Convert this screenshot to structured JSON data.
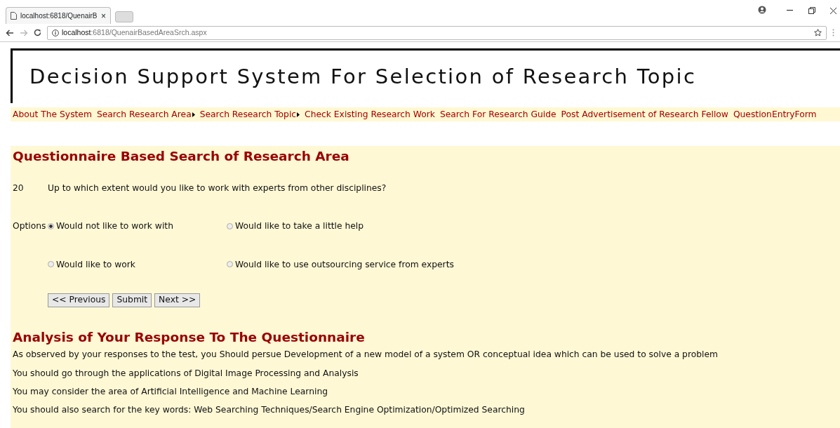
{
  "browser": {
    "tab_title": "localhost:6818/QuenairB",
    "tab_close": "×",
    "url_host": "localhost",
    "url_path": ":6818/QuenairBasedAreaSrch.aspx"
  },
  "header": {
    "title": "Decision Support System For Selection of Research Topic"
  },
  "menu": [
    {
      "label": "About The System",
      "has_submenu": false
    },
    {
      "label": "Search Research Area",
      "has_submenu": true
    },
    {
      "label": "Search Research Topic",
      "has_submenu": true
    },
    {
      "label": "Check Existing Research Work",
      "has_submenu": false
    },
    {
      "label": "Search For Research Guide",
      "has_submenu": false
    },
    {
      "label": "Post Advertisement of Research Fellow",
      "has_submenu": false
    },
    {
      "label": "QuestionEntryForm",
      "has_submenu": false
    }
  ],
  "questionnaire": {
    "heading": "Questionnaire Based Search of Research Area",
    "number": "20",
    "question": "Up to which extent would you like to work with experts from other disciplines?",
    "options_label": "Options",
    "options": [
      {
        "label": "Would not like to work with",
        "selected": true
      },
      {
        "label": "Would like to take a little help",
        "selected": false
      },
      {
        "label": "Would like to work",
        "selected": false
      },
      {
        "label": "Would like to use outsourcing service from experts",
        "selected": false
      }
    ],
    "buttons": [
      "<< Previous",
      "Submit",
      "Next >>"
    ]
  },
  "analysis": {
    "heading": "Analysis of Your Response To The Questionnaire",
    "lines": [
      "As observed by your responses to the test, you Should persue Development of a new model of a system OR conceptual idea which can be used to solve a problem",
      "You should go through the applications of Digital Image Processing and Analysis",
      "You may consider the area of Artificial Intelligence and Machine Learning",
      "You should also search for the key words: Web Searching Techniques/Search Engine Optimization/Optimized Searching"
    ]
  }
}
